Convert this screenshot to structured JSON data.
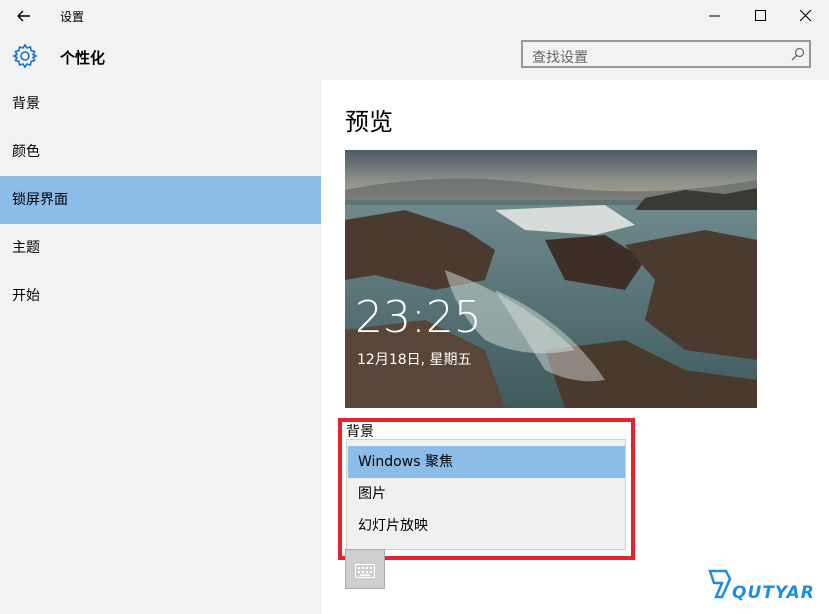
{
  "window": {
    "title": "设置"
  },
  "header": {
    "title": "个性化",
    "search_placeholder": "查找设置"
  },
  "sidebar": {
    "items": [
      {
        "label": "背景"
      },
      {
        "label": "颜色"
      },
      {
        "label": "锁屏界面",
        "selected": true
      },
      {
        "label": "主题"
      },
      {
        "label": "开始"
      }
    ]
  },
  "main": {
    "section_title": "预览",
    "lock_time": "23:25",
    "lock_date": "12月18日, 星期五",
    "background_label": "背景",
    "dropdown_options": [
      {
        "label": "Windows 聚焦",
        "selected": true
      },
      {
        "label": "图片"
      },
      {
        "label": "幻灯片放映"
      }
    ]
  },
  "watermark": {
    "text": "QUTYAR"
  },
  "colors": {
    "accent": "#8cbde8",
    "highlight": "#e8212a",
    "chrome": "#f2f2f2"
  }
}
